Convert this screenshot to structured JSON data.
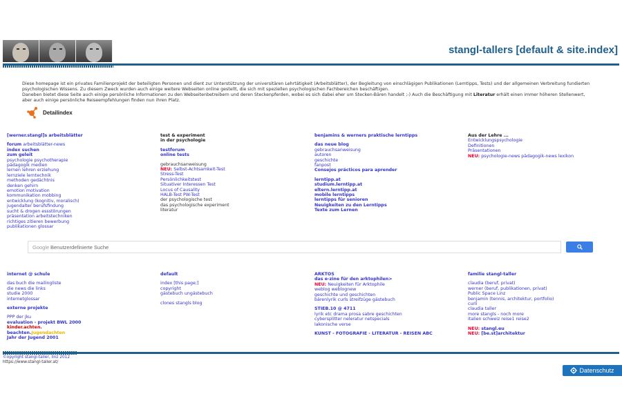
{
  "header": {
    "site_title": "stangl-tallers [default & site.index]"
  },
  "intro": {
    "line1": "Diese homepage ist ein privates Familienprojekt der beteiligten Personen und dient zur Unterstützung der universitären Lehrtätigkeit (Arbeitsblätter), der Begleitung von einschlägigen Publikationen (Lerntipps, Tests) und der allgemeinen Verbreitung fundierten psychologischen Wissens. Zu diesem Zweck wurden auch einige weitere Webseiten online gestellt, die sich mit speziellen psychologischen Fachbereichen beschäftigen.",
    "line2a": "Daneben bietet diese Seite auch einige persönliche Informationen zu den Webseitenbetreibern und deren Steckenpferden, wobei es sich dabei eher um Stecken-Bären handelt ;-) Auch die Beschäftigung mit ",
    "line2b": "Literatur",
    "line2c": " erhält einen immer höheren Stellenwert, aber auch einige persönliche Reiseempfehlungen finden nun ihren Platz."
  },
  "detail": {
    "title": "Detailindex",
    "icon": "network-icon",
    "icon_color": "#e8711e"
  },
  "col1": {
    "heading": "[werner.stangl]s arbeitsblätter",
    "forum_a": "forum",
    "forum_b": " arbeitsblätter-news",
    "index_suchen": "index suchen",
    "zum_geleit": "zum geleit",
    "items": [
      "psychologie psychotherapie",
      "pädagogik medien",
      "lernen lehren erziehung",
      "lernziele lerntechnik",
      "methoden gedächtnis",
      "denken gehirn",
      "emotion motivation",
      "kommunikation mobbing",
      "entwicklung (kognitiv, moralisch)",
      "jugendalter berufsfindung",
      "sucht & drogen essstörungen",
      "präsentation arbeitstechniken",
      "richtiges zitieren bewerbung",
      "publikationen glossar"
    ]
  },
  "col2": {
    "heading1": "test & experiment",
    "heading2": "in der psychologie",
    "testforum": "testforum",
    "online_tests": "online tests",
    "gebrauchs": "gebrauchsanweisung",
    "neu": "NEU:",
    "neu_item": " Selbst-Achtsamkeit-Test",
    "items": [
      "Stress-Test",
      "Persönlichkeitstest",
      "Situativer Interessen Test",
      "Locus of Causality",
      "HALB-Test PW-Test"
    ],
    "dark_items": [
      "der psychologische test",
      "das psychologische experiment",
      "literatur"
    ]
  },
  "col3": {
    "heading": "benjamins & werners praktische lerntipps",
    "das_neue_blog": "das neue blog",
    "items": [
      "gebrauchsanweisung",
      "autoren",
      "geschichte",
      "fanpost"
    ],
    "consejos": "Consejos prácticos para aprender",
    "bold_items": [
      "lerntipp.at",
      "studium.lerntipp.at",
      "eltern.lerntipp.at",
      "mobile lerntipps",
      "lerntipps für senioren",
      "Neuigkeiten zu den Lerntipps",
      "Texte zum Lernen"
    ]
  },
  "col4": {
    "heading": "Aus der Lehre ...",
    "items": [
      "Entwicklungspsychologie",
      "Definitionen",
      "Präsentationen"
    ],
    "neu": "NEU:",
    "neu_item": " psychologie-news pädagogik-news lexikon"
  },
  "search": {
    "google": "Google",
    "placeholder": "Benutzerdefinierte Suche"
  },
  "col5": {
    "heading": "internet @ schule",
    "items": [
      "das buch die mailingliste",
      "die news die links",
      "studie 2000",
      "internetglossar"
    ],
    "externe": "externe projekte",
    "ppp": "PPP der jku",
    "evaluation": "evaluation - projekt BWL 2000",
    "kinder": "kinder.achten.",
    "beachten_a": "beachten.",
    "beachten_b": "Jugendachten",
    "jahr": "Jahr der Jugend 2001"
  },
  "col6": {
    "heading": "default",
    "items": [
      "index [this page;]",
      "copyright",
      "gästebuch ungästebuch"
    ],
    "clones": "clones stangls blog"
  },
  "col7": {
    "heading1": "ARKTOS",
    "heading2": "das e-zine für den arktophilen>",
    "neu": "NEU:",
    "neu_item": " Neuigkeiten für Arktophile",
    "items": [
      "weblog weblognew",
      "geschichte und geschichten",
      "bärenlyrik curls streifzüge gästebuch"
    ],
    "stieb": "STIEB.10 @ 4711",
    "items2": [
      "lyrik etc drama prosa sabre geschichten",
      "cybersplitter neleratur netspecials",
      "lakonische verse"
    ],
    "kunst": "KUNST - FOTOGRAFIE - LITERATUR - REISEN ABC"
  },
  "col8": {
    "heading": "familie stangl-taller",
    "items": [
      "claudia (beruf, privat)",
      "werner (beruf, publikationen, privat)",
      "Public Space Linz",
      "benjamin (tennis, architektur, portfolio)",
      "curli",
      "claudia taller",
      "more stangls - noch more",
      "italien schweiz reise1 reise2"
    ],
    "neu1": "NEU:",
    "neu1_item": " stangl.eu",
    "neu2": "NEU:",
    "neu2_item": " [be.st]architektur"
  },
  "footer": {
    "copyright": "©opyright stangl-taller, linz 2012",
    "url": "https://www.stangl-taller.at/"
  },
  "privacy": {
    "label": "Datenschutz",
    "icon": "gear-icon"
  },
  "colors": {
    "brand_blue": "#1f5f8b",
    "link": "#3333cc",
    "neu_red": "#ee0033",
    "button_blue": "#3a7ee6"
  }
}
